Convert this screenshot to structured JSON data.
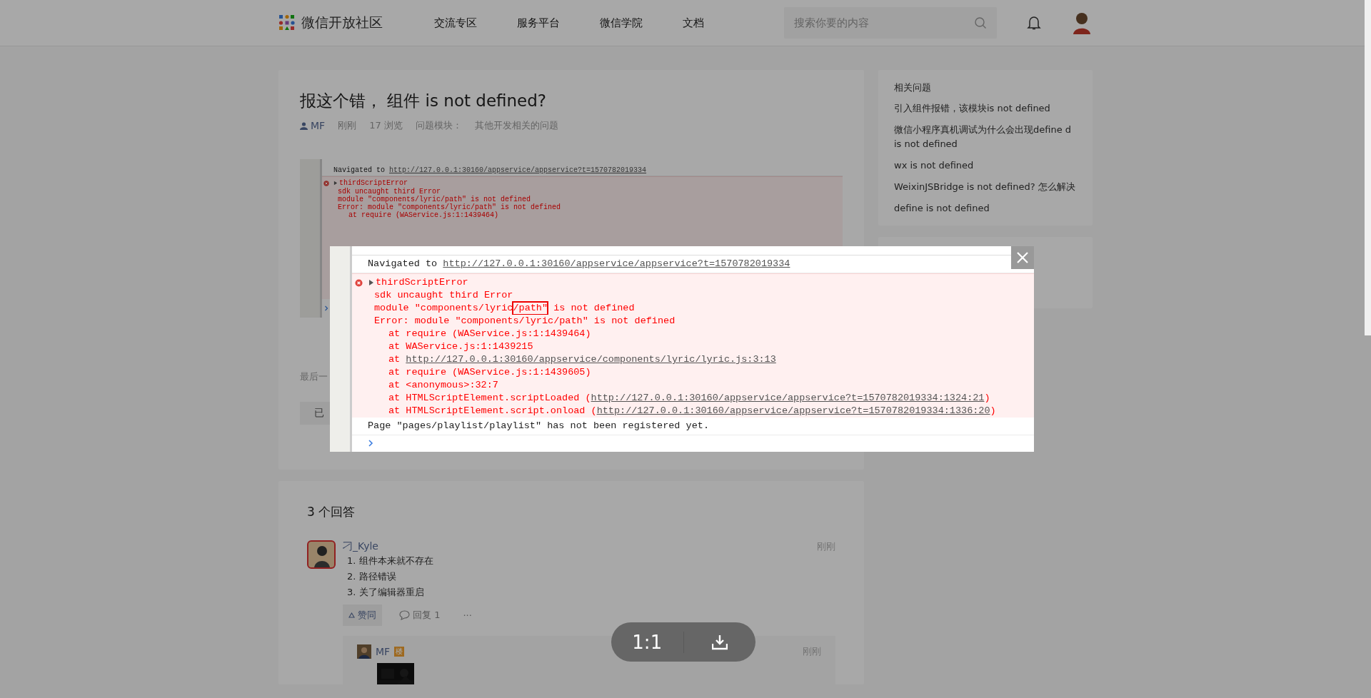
{
  "header": {
    "logo_text": "微信开放社区",
    "nav": [
      {
        "label": "交流专区"
      },
      {
        "label": "服务平台"
      },
      {
        "label": "微信学院"
      },
      {
        "label": "文档"
      }
    ],
    "search": {
      "placeholder": "搜索你要的内容"
    }
  },
  "question": {
    "title": "报这个错， 组件 is not defined?",
    "author": "MF",
    "time": "刚刚",
    "views": "17 浏览",
    "module_label": "问题模块：",
    "module": "其他开发相关的问题",
    "screenshot_lines": [
      {
        "kind": "info",
        "text": "Navigated to ",
        "link": "http://127.0.0.1:30160/appservice/appservice?t=1570782019334"
      },
      {
        "kind": "error_head",
        "text": "thirdScriptError"
      },
      {
        "kind": "error",
        "text": "sdk uncaught third Error"
      },
      {
        "kind": "error",
        "text": "module \"components/lyric/path\" is not defined"
      },
      {
        "kind": "error",
        "text": "Error: module \"components/lyric/path\" is not defined"
      },
      {
        "kind": "stack",
        "text": "at require (WAService.js:1:1439464)"
      }
    ],
    "footer_text": "最后一",
    "button": "已"
  },
  "sidebar": {
    "title": "相关问题",
    "items": [
      "引入组件报错，该模块is not defined",
      "微信小程序真机调试为什么会出现define d is not defined",
      "wx is not defined",
      "WeixinJSBridge is not defined?  怎么解决",
      "define is not defined"
    ]
  },
  "answers": {
    "count": "3 个回答",
    "items": [
      {
        "author": "刁_Kyle",
        "time": "刚刚",
        "lines": [
          "1. 组件本来就不存在",
          "2. 路径错误",
          "3. 关了编辑器重启"
        ],
        "like": "赞同",
        "reply": "回复 1",
        "more": "···",
        "comment": {
          "author": "MF",
          "badge": "楼",
          "time": "刚刚"
        }
      }
    ]
  },
  "viewer": {
    "lines": [
      {
        "kind": "info",
        "text": "Navigated to ",
        "link": "http://127.0.0.1:30160/appservice/appservice?t=1570782019334"
      },
      {
        "kind": "error_head",
        "text": "thirdScriptError"
      },
      {
        "kind": "error",
        "text": "sdk uncaught third Error"
      },
      {
        "kind": "error",
        "text": "module \"components/lyric",
        "highlight": "/path\"",
        "suffix": " is not defined"
      },
      {
        "kind": "error",
        "text": "Error: module \"components/lyric/path\" is not defined"
      },
      {
        "kind": "stack",
        "text": "at require (WAService.js:1:1439464)"
      },
      {
        "kind": "stack",
        "text": "at WAService.js:1:1439215"
      },
      {
        "kind": "stack",
        "text": "at ",
        "link": "http://127.0.0.1:30160/appservice/components/lyric/lyric.js:3:13"
      },
      {
        "kind": "stack",
        "text": "at require (WAService.js:1:1439605)"
      },
      {
        "kind": "stack",
        "text": "at <anonymous>:32:7"
      },
      {
        "kind": "stack",
        "text": "at HTMLScriptElement.scriptLoaded (",
        "link": "http://127.0.0.1:30160/appservice/appservice?t=1570782019334:1324:21",
        "suffix": ")"
      },
      {
        "kind": "stack",
        "text": "at HTMLScriptElement.script.onload (",
        "link": "http://127.0.0.1:30160/appservice/appservice?t=1570782019334:1336:20",
        "suffix": ")"
      },
      {
        "kind": "info",
        "text": "Page \"pages/playlist/playlist\" has not been registered yet."
      },
      {
        "kind": "prompt"
      }
    ],
    "zoom_label": "1:1"
  }
}
